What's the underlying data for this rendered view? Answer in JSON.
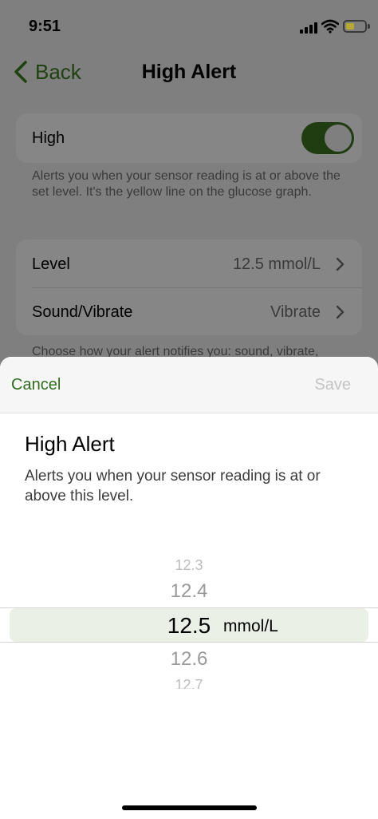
{
  "status_bar": {
    "time": "9:51"
  },
  "nav": {
    "back_label": "Back",
    "title": "High Alert"
  },
  "settings": {
    "high_label": "High",
    "high_enabled": true,
    "high_helper": "Alerts you when your sensor reading is at or above the set level. It's the yellow line on the glucose graph.",
    "rows": [
      {
        "label": "Level",
        "value": "12.5 mmol/L"
      },
      {
        "label": "Sound/Vibrate",
        "value": "Vibrate"
      }
    ],
    "sound_helper": "Choose how your alert notifies you: sound, vibrate,"
  },
  "sheet": {
    "cancel_label": "Cancel",
    "save_label": "Save",
    "title": "High Alert",
    "description": "Alerts you when your sensor reading is at or above this level."
  },
  "picker": {
    "options": [
      "12.3",
      "12.4",
      "12.5",
      "12.6",
      "12.7"
    ],
    "selected": "12.5",
    "unit": "mmol/L"
  },
  "colors": {
    "accent_green": "#2f6d1d",
    "toggle_on": "#1f3d11",
    "save_disabled": "#c4c4c4",
    "picker_highlight": "#eaf0e5"
  }
}
